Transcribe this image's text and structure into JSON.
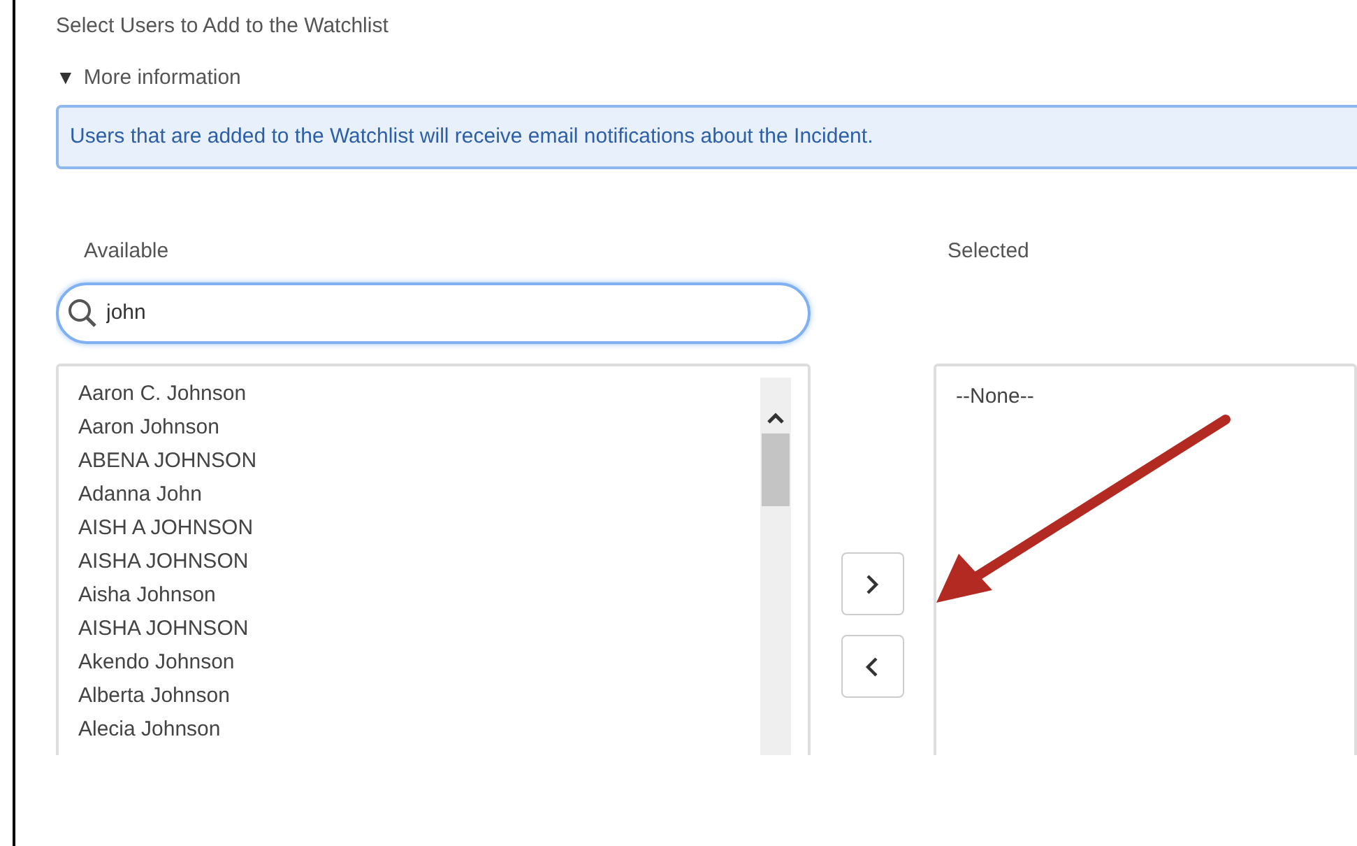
{
  "title": "Select Users to Add to the Watchlist",
  "more_info": {
    "toggle": "▼",
    "label": "More information",
    "expanded": true
  },
  "info_message": "Users that are added to the Watchlist will receive email notifications about the Incident.",
  "available": {
    "label": "Available",
    "search": {
      "value": "john"
    },
    "items": [
      "Aaron C. Johnson",
      "Aaron Johnson",
      "ABENA JOHNSON",
      "Adanna John",
      "AISH A JOHNSON",
      "AISHA JOHNSON",
      "Aisha Johnson",
      "AISHA JOHNSON",
      "Akendo Johnson",
      "Alberta Johnson",
      "Alecia Johnson"
    ]
  },
  "selected": {
    "label": "Selected",
    "items": [
      "--None--"
    ]
  }
}
